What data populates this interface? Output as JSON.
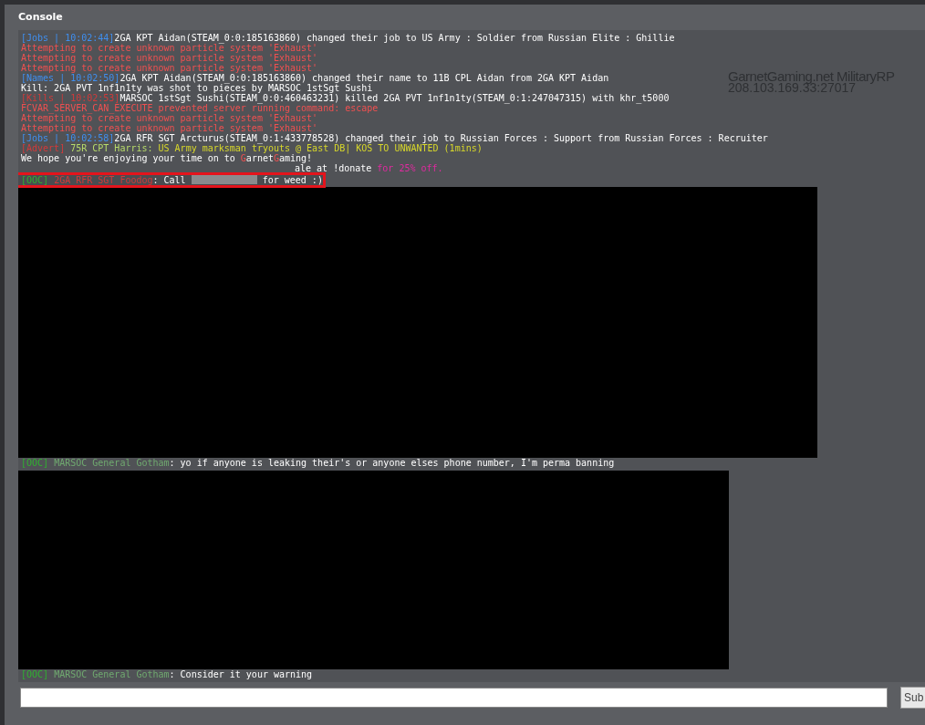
{
  "window": {
    "title": "Console"
  },
  "background_server": {
    "name": "GarnetGaming.net MilitaryRP",
    "address": "208.103.169.33:27017"
  },
  "log": [
    {
      "kind": "line",
      "segments": [
        {
          "kind": "tag",
          "text": "[Jobs | 10:02:44]"
        },
        {
          "kind": "message",
          "text": "2GA KPT Aidan(STEAM_0:0:185163860) changed their job to US Army : Soldier from Russian Elite : Ghillie"
        }
      ]
    },
    {
      "kind": "line",
      "segments": [
        {
          "kind": "error",
          "text": "Attempting to create unknown particle system 'Exhaust'"
        }
      ]
    },
    {
      "kind": "line",
      "segments": [
        {
          "kind": "error",
          "text": "Attempting to create unknown particle system 'Exhaust'"
        }
      ]
    },
    {
      "kind": "line",
      "segments": [
        {
          "kind": "error",
          "text": "Attempting to create unknown particle system 'Exhaust'"
        }
      ]
    },
    {
      "kind": "line",
      "segments": [
        {
          "kind": "tag",
          "text": "[Names | 10:02:50]"
        },
        {
          "kind": "message",
          "text": "2GA KPT Aidan(STEAM_0:0:185163860) changed their name to 11B CPL Aidan from 2GA KPT Aidan"
        }
      ]
    },
    {
      "kind": "line",
      "segments": [
        {
          "kind": "message",
          "text": "Kill: 2GA PVT 1nf1n1ty was shot to pieces by MARSOC 1stSgt Sushi"
        }
      ]
    },
    {
      "kind": "line",
      "segments": [
        {
          "kind": "kill_tag",
          "text": "[Kills | 10:02:53]"
        },
        {
          "kind": "message",
          "text": "MARSOC 1stSgt Sushi(STEAM_0:0:460463231) killed 2GA PVT 1nf1n1ty(STEAM_0:1:247047315) with khr_t5000"
        }
      ]
    },
    {
      "kind": "line",
      "segments": [
        {
          "kind": "error",
          "text": "FCVAR_SERVER_CAN_EXECUTE prevented server running command: escape"
        }
      ]
    },
    {
      "kind": "line",
      "segments": [
        {
          "kind": "error",
          "text": "Attempting to create unknown particle system 'Exhaust'"
        }
      ]
    },
    {
      "kind": "line",
      "segments": [
        {
          "kind": "error",
          "text": "Attempting to create unknown particle system 'Exhaust'"
        }
      ]
    },
    {
      "kind": "line",
      "segments": [
        {
          "kind": "tag",
          "text": "[Jobs | 10:02:58]"
        },
        {
          "kind": "message",
          "text": "2GA RFR SGT Arcturus(STEAM_0:1:433778528) changed their job to Russian Forces : Support from Russian Forces : Recruiter"
        }
      ]
    },
    {
      "kind": "line",
      "segments": [
        {
          "kind": "kill_tag",
          "text": "[Advert]"
        },
        {
          "kind": "speaker",
          "text": " 75R CPT Harris: "
        },
        {
          "kind": "advert",
          "text": "US Army marksman tryouts @ East DB| KOS TO UNWANTED (1mins)"
        }
      ]
    },
    {
      "kind": "line",
      "segments": [
        {
          "kind": "message",
          "text": "We hope you're enjoying your time on to "
        },
        {
          "kind": "error",
          "text": "G"
        },
        {
          "kind": "message",
          "text": "arnet"
        },
        {
          "kind": "error",
          "text": "G"
        },
        {
          "kind": "message",
          "text": "aming!"
        }
      ]
    },
    {
      "kind": "partial",
      "segments": [
        {
          "kind": "message",
          "text": "ale at !donate "
        },
        {
          "kind": "promo",
          "text": "for 25% off."
        }
      ]
    },
    {
      "kind": "line",
      "highlighted": true,
      "segments": [
        {
          "kind": "ooc_tag",
          "text": "[OOC]"
        },
        {
          "kind": "kill_tag",
          "text": " 2GA RFR SGT Foodog"
        },
        {
          "kind": "message",
          "text": ": Call "
        },
        {
          "kind": "redacted"
        },
        {
          "kind": "message",
          "text": " for weed :)"
        }
      ]
    },
    {
      "kind": "redaction_wide"
    },
    {
      "kind": "line",
      "segments": [
        {
          "kind": "ooc_tag",
          "text": "[OOC]"
        },
        {
          "kind": "player",
          "text": " MARSOC General Gotham"
        },
        {
          "kind": "message",
          "text": ": yo if anyone is leaking their's or anyone elses phone number, I'm perma banning"
        }
      ]
    },
    {
      "kind": "redaction_narrow"
    },
    {
      "kind": "line",
      "segments": [
        {
          "kind": "ooc_tag",
          "text": "[OOC]"
        },
        {
          "kind": "player",
          "text": " MARSOC General Gotham"
        },
        {
          "kind": "message",
          "text": ": Consider it your warning"
        }
      ]
    }
  ],
  "submit_button": "Sub"
}
